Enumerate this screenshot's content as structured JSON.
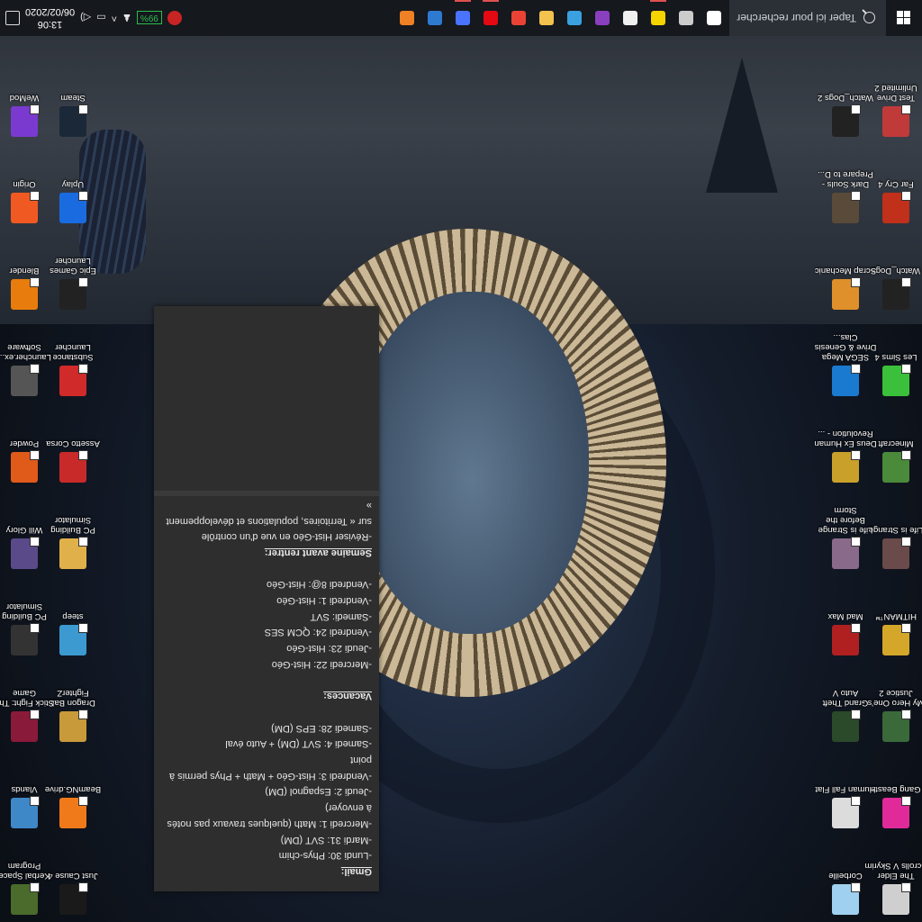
{
  "taskbar": {
    "search_placeholder": "Taper ici pour rechercher",
    "battery": "99%",
    "time": "13:06",
    "date": "06/02/2020",
    "pinned": [
      {
        "name": "cortana-icon",
        "color": "#ffffff",
        "active": false
      },
      {
        "name": "task-view-icon",
        "color": "#cccccc",
        "active": false
      },
      {
        "name": "sticky-notes-icon",
        "color": "#f5d400",
        "active": true
      },
      {
        "name": "file-icon",
        "color": "#f0f0f0",
        "active": false
      },
      {
        "name": "obs-icon",
        "color": "#8a3fbf",
        "active": false
      },
      {
        "name": "store-icon",
        "color": "#3aa0e0",
        "active": false
      },
      {
        "name": "file-explorer-icon",
        "color": "#f2c14e",
        "active": false
      },
      {
        "name": "chrome-icon",
        "color": "#ea4335",
        "active": false
      },
      {
        "name": "netflix-icon",
        "color": "#e50914",
        "active": true
      },
      {
        "name": "ubisoft-icon",
        "color": "#4a74ff",
        "active": true
      },
      {
        "name": "edge-icon",
        "color": "#2e7ad1",
        "active": false
      },
      {
        "name": "blender-icon",
        "color": "#f08024",
        "active": false
      }
    ]
  },
  "desktop_left": [
    {
      "label": "Just Cause 4",
      "color": "#1a1a1a"
    },
    {
      "label": "Kerbal Space Program",
      "color": "#4a6b2b"
    },
    {
      "label": "BeamNG.drive",
      "color": "#f07a1a"
    },
    {
      "label": "Vlands",
      "color": "#3f88c8"
    },
    {
      "label": "Dragon Ball FighterZ",
      "color": "#c89a3a"
    },
    {
      "label": "Stick Fight: The Game",
      "color": "#8a1a3a"
    },
    {
      "label": "steep",
      "color": "#3c9ad0"
    },
    {
      "label": "PC Building Simulator",
      "color": "#333333"
    },
    {
      "label": "PC Building Simulator",
      "color": "#e0b14a"
    },
    {
      "label": "Will Glory",
      "color": "#5a4a8a"
    },
    {
      "label": "Assetto Corsa",
      "color": "#c82a2a"
    },
    {
      "label": "Powder",
      "color": "#e05a1a"
    },
    {
      "label": "Substance Launcher",
      "color": "#d02a2a"
    },
    {
      "label": "Launcher.ex... Software",
      "color": "#555555"
    },
    {
      "label": "Epic Games Launcher",
      "color": "#222222"
    },
    {
      "label": "Blender",
      "color": "#e87d0d"
    },
    {
      "label": "Uplay",
      "color": "#1a6be0"
    },
    {
      "label": "Origin",
      "color": "#f05a22"
    },
    {
      "label": "Steam",
      "color": "#1b2838"
    },
    {
      "label": "WeMod",
      "color": "#7a3ad0"
    }
  ],
  "desktop_right": [
    {
      "label": "The Elder Scrolls V Skyrim",
      "color": "#cfcfcf"
    },
    {
      "label": "Corbeille",
      "color": "#9fd0f0"
    },
    {
      "label": "Gang Beasts",
      "color": "#e02a9a"
    },
    {
      "label": "Human Fall Flat",
      "color": "#dcdcdc"
    },
    {
      "label": "My Hero One's Justice 2",
      "color": "#3a6a3a"
    },
    {
      "label": "Grand Theft Auto V",
      "color": "#2a4a2a"
    },
    {
      "label": "HITMAN™",
      "color": "#d4a62a"
    },
    {
      "label": "Mad Max",
      "color": "#b02020"
    },
    {
      "label": "Life is Strange",
      "color": "#6a4a4a"
    },
    {
      "label": "Life is Strange Before the Storm",
      "color": "#8a6a8a"
    },
    {
      "label": "Minecraft",
      "color": "#4a8a3a"
    },
    {
      "label": "Deus Ex Human Revolution - ...",
      "color": "#c8a02a"
    },
    {
      "label": "Les Sims 4",
      "color": "#3ac03a"
    },
    {
      "label": "SEGA Mega Drive & Genesis Clas...",
      "color": "#1a7ad0"
    },
    {
      "label": "Watch_Dogs",
      "color": "#222222"
    },
    {
      "label": "Scrap Mechanic",
      "color": "#e0902a"
    },
    {
      "label": "Far Cry 4",
      "color": "#c0301a"
    },
    {
      "label": "Dark Souls - Prepare to D...",
      "color": "#5a4a3a"
    },
    {
      "label": "Test Drive Unlimited 2",
      "color": "#c03a3a"
    },
    {
      "label": "Watch_Dogs 2",
      "color": "#222222"
    }
  ],
  "note": {
    "lines": [
      {
        "text": "Gmail:",
        "h": true
      },
      {
        "text": "-Lundi 30: Phys-chim"
      },
      {
        "text": "-Mardi 31: SVT (DM)"
      },
      {
        "text": "-Mercredi 1: Math (quelques travaux pas notés à envoyer)"
      },
      {
        "text": "-Jeudi 2: Espagnol (DM)"
      },
      {
        "text": "-Vendredi 3: Hist-Géo + Math + Phys permis à point"
      },
      {
        "text": "-Samedi 4: SVT (DM) + Auto éval"
      },
      {
        "text": "-Samedi 28: EPS (DM)"
      },
      {
        "text": ""
      },
      {
        "text": "Vacances:",
        "h": true
      },
      {
        "text": ""
      },
      {
        "text": "-Mercredi 22: Hist-Géo"
      },
      {
        "text": "-Jeudi 23: Hist-Géo"
      },
      {
        "text": "-Vendredi 24: QCM SES"
      },
      {
        "text": "-Samedi: SVT"
      },
      {
        "text": "-Vendredi 1: Hist-Géo"
      },
      {
        "text": "-Vendredi 8@: Hist-Géo"
      },
      {
        "text": ""
      },
      {
        "text": "Semaine avant rentrer:",
        "h": true
      },
      {
        "text": "-Réviser Hist-Géo en vue d'un contrôle"
      },
      {
        "text": "sur « Territoires, populations et développement »"
      }
    ]
  }
}
